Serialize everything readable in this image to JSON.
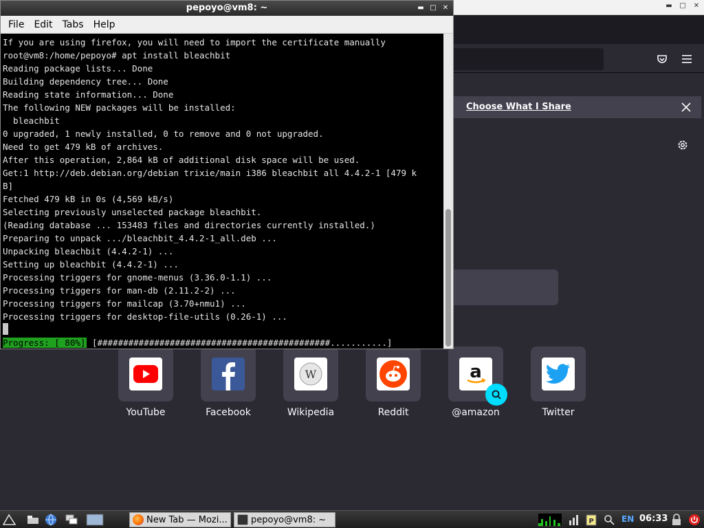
{
  "terminal": {
    "title": "pepoyo@vm8: ~",
    "menu": [
      "File",
      "Edit",
      "Tabs",
      "Help"
    ],
    "lines": [
      "If you are using firefox, you will need to import the certificate manually",
      "root@vm8:/home/pepoyo# apt install bleachbit",
      "Reading package lists... Done",
      "Building dependency tree... Done",
      "Reading state information... Done",
      "The following NEW packages will be installed:",
      "  bleachbit",
      "0 upgraded, 1 newly installed, 0 to remove and 0 not upgraded.",
      "Need to get 479 kB of archives.",
      "After this operation, 2,864 kB of additional disk space will be used.",
      "Get:1 http://deb.debian.org/debian trixie/main i386 bleachbit all 4.4.2-1 [479 k",
      "B]",
      "Fetched 479 kB in 0s (4,569 kB/s)",
      "Selecting previously unselected package bleachbit.",
      "(Reading database ... 153483 files and directories currently installed.)",
      "Preparing to unpack .../bleachbit_4.4.2-1_all.deb ...",
      "Unpacking bleachbit (4.4.2-1) ...",
      "Setting up bleachbit (4.4.2-1) ...",
      "Processing triggers for gnome-menus (3.36.0-1.1) ...",
      "Processing triggers for man-db (2.11.2-2) ...",
      "Processing triggers for mailcap (3.70+nmu1) ...",
      "Processing triggers for desktop-file-utils (0.26-1) ..."
    ],
    "progress_label": "Progress: [ 80%]",
    "progress_bar": " [#############################################...........]",
    "progress_fraction": 0.8
  },
  "firefox": {
    "notice_label": "Choose What I Share",
    "shortcuts": [
      {
        "label": "YouTube",
        "icon": "youtube-icon",
        "color": "#ff0000"
      },
      {
        "label": "Facebook",
        "icon": "facebook-icon",
        "color": "#1877f2"
      },
      {
        "label": "Wikipedia",
        "icon": "wikipedia-icon",
        "color": "#cccccc"
      },
      {
        "label": "Reddit",
        "icon": "reddit-icon",
        "color": "#ff4500"
      },
      {
        "label": "@amazon",
        "icon": "amazon-icon",
        "color": "#ff9900"
      },
      {
        "label": "Twitter",
        "icon": "twitter-icon",
        "color": "#1da1f2"
      }
    ]
  },
  "taskbar": {
    "tasks": [
      {
        "label": "New Tab — Mozi...",
        "icon": "firefox-icon"
      },
      {
        "label": "pepoyo@vm8: ~",
        "icon": "terminal-icon"
      }
    ],
    "language": "EN",
    "clock": "06:33"
  }
}
